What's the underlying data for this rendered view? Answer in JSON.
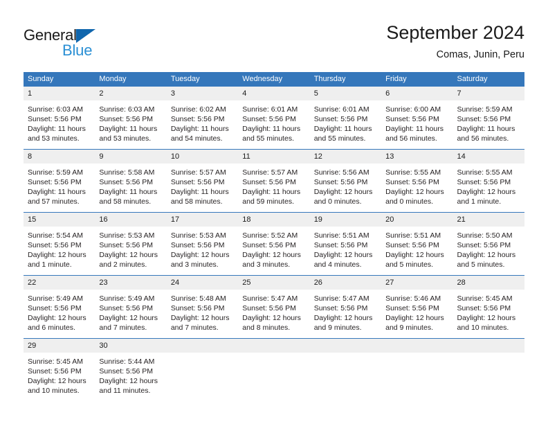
{
  "brand": {
    "name_part1": "General",
    "name_part2": "Blue",
    "logo_icon": "triangle-right-icon",
    "color_primary": "#1066ad",
    "color_secondary": "#2a8fd4"
  },
  "header": {
    "title": "September 2024",
    "subtitle": "Comas, Junin, Peru"
  },
  "theme": {
    "header_row_bg": "#3577bb",
    "daynum_bg": "#efefef",
    "week_divider": "#3577bb",
    "text": "#231f20"
  },
  "weekday_headers": [
    "Sunday",
    "Monday",
    "Tuesday",
    "Wednesday",
    "Thursday",
    "Friday",
    "Saturday"
  ],
  "weeks": [
    [
      {
        "day": "1",
        "sunrise": "Sunrise: 6:03 AM",
        "sunset": "Sunset: 5:56 PM",
        "daylight1": "Daylight: 11 hours",
        "daylight2": "and 53 minutes."
      },
      {
        "day": "2",
        "sunrise": "Sunrise: 6:03 AM",
        "sunset": "Sunset: 5:56 PM",
        "daylight1": "Daylight: 11 hours",
        "daylight2": "and 53 minutes."
      },
      {
        "day": "3",
        "sunrise": "Sunrise: 6:02 AM",
        "sunset": "Sunset: 5:56 PM",
        "daylight1": "Daylight: 11 hours",
        "daylight2": "and 54 minutes."
      },
      {
        "day": "4",
        "sunrise": "Sunrise: 6:01 AM",
        "sunset": "Sunset: 5:56 PM",
        "daylight1": "Daylight: 11 hours",
        "daylight2": "and 55 minutes."
      },
      {
        "day": "5",
        "sunrise": "Sunrise: 6:01 AM",
        "sunset": "Sunset: 5:56 PM",
        "daylight1": "Daylight: 11 hours",
        "daylight2": "and 55 minutes."
      },
      {
        "day": "6",
        "sunrise": "Sunrise: 6:00 AM",
        "sunset": "Sunset: 5:56 PM",
        "daylight1": "Daylight: 11 hours",
        "daylight2": "and 56 minutes."
      },
      {
        "day": "7",
        "sunrise": "Sunrise: 5:59 AM",
        "sunset": "Sunset: 5:56 PM",
        "daylight1": "Daylight: 11 hours",
        "daylight2": "and 56 minutes."
      }
    ],
    [
      {
        "day": "8",
        "sunrise": "Sunrise: 5:59 AM",
        "sunset": "Sunset: 5:56 PM",
        "daylight1": "Daylight: 11 hours",
        "daylight2": "and 57 minutes."
      },
      {
        "day": "9",
        "sunrise": "Sunrise: 5:58 AM",
        "sunset": "Sunset: 5:56 PM",
        "daylight1": "Daylight: 11 hours",
        "daylight2": "and 58 minutes."
      },
      {
        "day": "10",
        "sunrise": "Sunrise: 5:57 AM",
        "sunset": "Sunset: 5:56 PM",
        "daylight1": "Daylight: 11 hours",
        "daylight2": "and 58 minutes."
      },
      {
        "day": "11",
        "sunrise": "Sunrise: 5:57 AM",
        "sunset": "Sunset: 5:56 PM",
        "daylight1": "Daylight: 11 hours",
        "daylight2": "and 59 minutes."
      },
      {
        "day": "12",
        "sunrise": "Sunrise: 5:56 AM",
        "sunset": "Sunset: 5:56 PM",
        "daylight1": "Daylight: 12 hours",
        "daylight2": "and 0 minutes."
      },
      {
        "day": "13",
        "sunrise": "Sunrise: 5:55 AM",
        "sunset": "Sunset: 5:56 PM",
        "daylight1": "Daylight: 12 hours",
        "daylight2": "and 0 minutes."
      },
      {
        "day": "14",
        "sunrise": "Sunrise: 5:55 AM",
        "sunset": "Sunset: 5:56 PM",
        "daylight1": "Daylight: 12 hours",
        "daylight2": "and 1 minute."
      }
    ],
    [
      {
        "day": "15",
        "sunrise": "Sunrise: 5:54 AM",
        "sunset": "Sunset: 5:56 PM",
        "daylight1": "Daylight: 12 hours",
        "daylight2": "and 1 minute."
      },
      {
        "day": "16",
        "sunrise": "Sunrise: 5:53 AM",
        "sunset": "Sunset: 5:56 PM",
        "daylight1": "Daylight: 12 hours",
        "daylight2": "and 2 minutes."
      },
      {
        "day": "17",
        "sunrise": "Sunrise: 5:53 AM",
        "sunset": "Sunset: 5:56 PM",
        "daylight1": "Daylight: 12 hours",
        "daylight2": "and 3 minutes."
      },
      {
        "day": "18",
        "sunrise": "Sunrise: 5:52 AM",
        "sunset": "Sunset: 5:56 PM",
        "daylight1": "Daylight: 12 hours",
        "daylight2": "and 3 minutes."
      },
      {
        "day": "19",
        "sunrise": "Sunrise: 5:51 AM",
        "sunset": "Sunset: 5:56 PM",
        "daylight1": "Daylight: 12 hours",
        "daylight2": "and 4 minutes."
      },
      {
        "day": "20",
        "sunrise": "Sunrise: 5:51 AM",
        "sunset": "Sunset: 5:56 PM",
        "daylight1": "Daylight: 12 hours",
        "daylight2": "and 5 minutes."
      },
      {
        "day": "21",
        "sunrise": "Sunrise: 5:50 AM",
        "sunset": "Sunset: 5:56 PM",
        "daylight1": "Daylight: 12 hours",
        "daylight2": "and 5 minutes."
      }
    ],
    [
      {
        "day": "22",
        "sunrise": "Sunrise: 5:49 AM",
        "sunset": "Sunset: 5:56 PM",
        "daylight1": "Daylight: 12 hours",
        "daylight2": "and 6 minutes."
      },
      {
        "day": "23",
        "sunrise": "Sunrise: 5:49 AM",
        "sunset": "Sunset: 5:56 PM",
        "daylight1": "Daylight: 12 hours",
        "daylight2": "and 7 minutes."
      },
      {
        "day": "24",
        "sunrise": "Sunrise: 5:48 AM",
        "sunset": "Sunset: 5:56 PM",
        "daylight1": "Daylight: 12 hours",
        "daylight2": "and 7 minutes."
      },
      {
        "day": "25",
        "sunrise": "Sunrise: 5:47 AM",
        "sunset": "Sunset: 5:56 PM",
        "daylight1": "Daylight: 12 hours",
        "daylight2": "and 8 minutes."
      },
      {
        "day": "26",
        "sunrise": "Sunrise: 5:47 AM",
        "sunset": "Sunset: 5:56 PM",
        "daylight1": "Daylight: 12 hours",
        "daylight2": "and 9 minutes."
      },
      {
        "day": "27",
        "sunrise": "Sunrise: 5:46 AM",
        "sunset": "Sunset: 5:56 PM",
        "daylight1": "Daylight: 12 hours",
        "daylight2": "and 9 minutes."
      },
      {
        "day": "28",
        "sunrise": "Sunrise: 5:45 AM",
        "sunset": "Sunset: 5:56 PM",
        "daylight1": "Daylight: 12 hours",
        "daylight2": "and 10 minutes."
      }
    ],
    [
      {
        "day": "29",
        "sunrise": "Sunrise: 5:45 AM",
        "sunset": "Sunset: 5:56 PM",
        "daylight1": "Daylight: 12 hours",
        "daylight2": "and 10 minutes."
      },
      {
        "day": "30",
        "sunrise": "Sunrise: 5:44 AM",
        "sunset": "Sunset: 5:56 PM",
        "daylight1": "Daylight: 12 hours",
        "daylight2": "and 11 minutes."
      },
      {
        "day": "",
        "sunrise": "",
        "sunset": "",
        "daylight1": "",
        "daylight2": ""
      },
      {
        "day": "",
        "sunrise": "",
        "sunset": "",
        "daylight1": "",
        "daylight2": ""
      },
      {
        "day": "",
        "sunrise": "",
        "sunset": "",
        "daylight1": "",
        "daylight2": ""
      },
      {
        "day": "",
        "sunrise": "",
        "sunset": "",
        "daylight1": "",
        "daylight2": ""
      },
      {
        "day": "",
        "sunrise": "",
        "sunset": "",
        "daylight1": "",
        "daylight2": ""
      }
    ]
  ]
}
